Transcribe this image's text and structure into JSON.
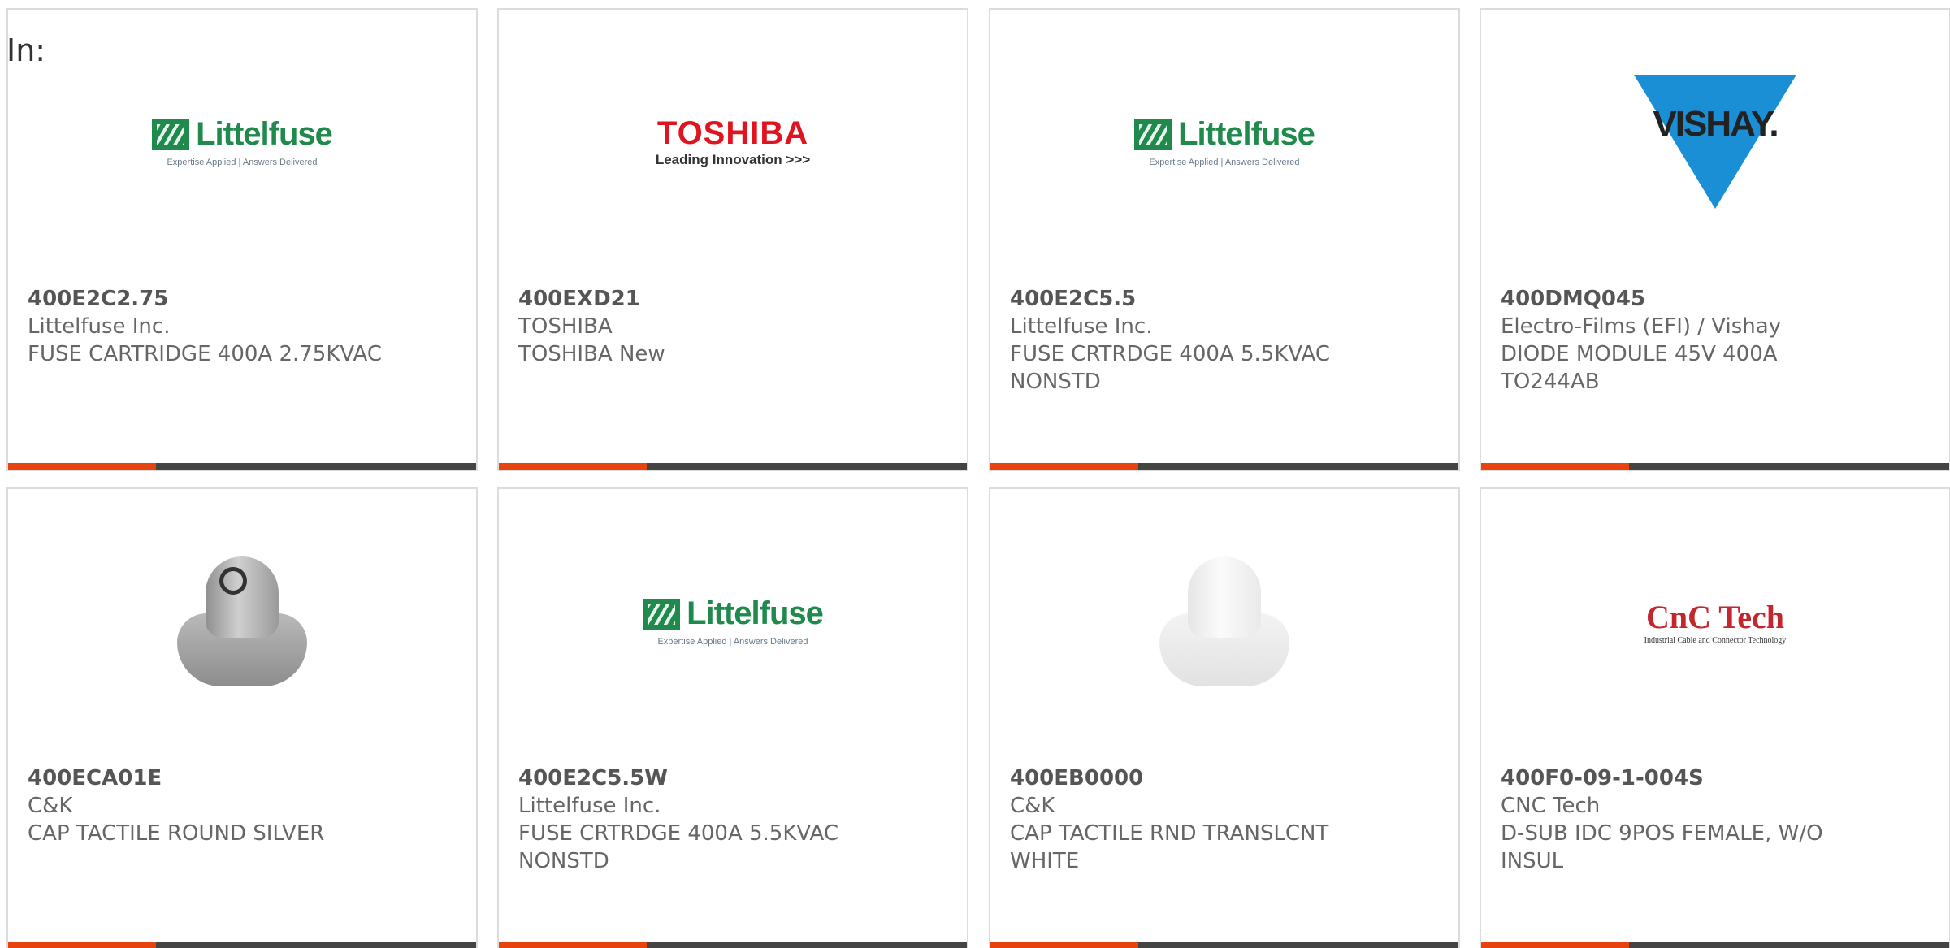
{
  "header": {
    "in_label": "In:"
  },
  "cards": [
    {
      "part_number": "400E2C2.75",
      "manufacturer": "Littelfuse Inc.",
      "description": "FUSE CARTRIDGE 400A 2.75KVAC",
      "logo": "littelfuse",
      "logo_text": "Littelfuse",
      "logo_tagline": "Expertise Applied | Answers Delivered"
    },
    {
      "part_number": "400EXD21",
      "manufacturer": "TOSHIBA",
      "description": "TOSHIBA New",
      "logo": "toshiba",
      "logo_text": "TOSHIBA",
      "logo_tagline": "Leading Innovation >>>"
    },
    {
      "part_number": "400E2C5.5",
      "manufacturer": "Littelfuse Inc.",
      "description": "FUSE CRTRDGE 400A 5.5KVAC NONSTD",
      "logo": "littelfuse",
      "logo_text": "Littelfuse",
      "logo_tagline": "Expertise Applied | Answers Delivered"
    },
    {
      "part_number": "400DMQ045",
      "manufacturer": "Electro-Films (EFI) / Vishay",
      "description": "DIODE MODULE 45V 400A TO244AB",
      "logo": "vishay",
      "logo_text": "VISHAY.",
      "logo_tagline": ""
    },
    {
      "part_number": "400ECA01E",
      "manufacturer": "C&K",
      "description": "CAP TACTILE ROUND SILVER",
      "logo": "cap-silver",
      "logo_text": "",
      "logo_tagline": ""
    },
    {
      "part_number": "400E2C5.5W",
      "manufacturer": "Littelfuse Inc.",
      "description": "FUSE CRTRDGE 400A 5.5KVAC NONSTD",
      "logo": "littelfuse",
      "logo_text": "Littelfuse",
      "logo_tagline": "Expertise Applied | Answers Delivered"
    },
    {
      "part_number": "400EB0000",
      "manufacturer": "C&K",
      "description": "CAP TACTILE RND TRANSLCNT WHITE",
      "logo": "cap-white",
      "logo_text": "",
      "logo_tagline": ""
    },
    {
      "part_number": "400F0-09-1-004S",
      "manufacturer": "CNC Tech",
      "description": "D-SUB IDC 9POS FEMALE, W/O INSUL",
      "logo": "cnc",
      "logo_text": "CnC Tech",
      "logo_tagline": "Industrial Cable and Connector Technology"
    }
  ],
  "colors": {
    "accent": "#e8420f",
    "bar": "#444444",
    "border": "#dcdcdc",
    "text": "#666666"
  }
}
